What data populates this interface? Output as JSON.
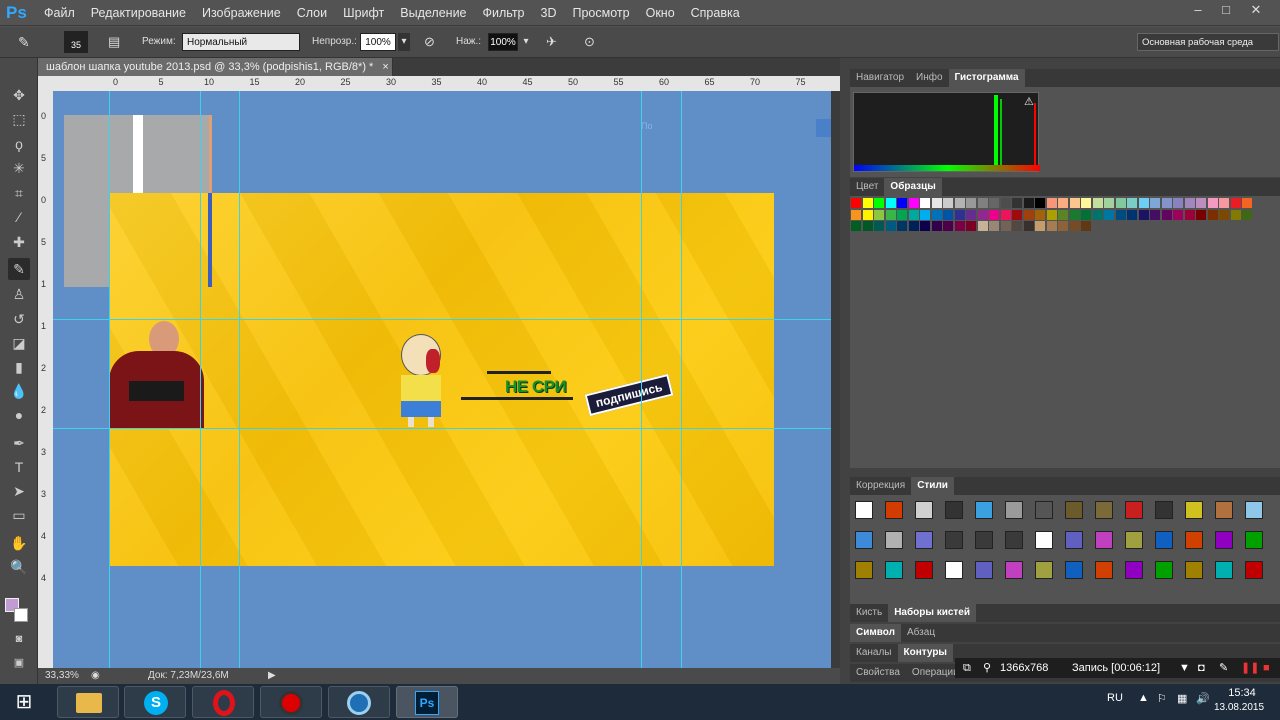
{
  "app": {
    "logo": "Ps"
  },
  "menu": [
    "Файл",
    "Редактирование",
    "Изображение",
    "Слои",
    "Шрифт",
    "Выделение",
    "Фильтр",
    "3D",
    "Просмотр",
    "Окно",
    "Справка"
  ],
  "window_controls": {
    "minimize": "–",
    "restore": "□",
    "close": "✕"
  },
  "options": {
    "brush_size": "35",
    "mode_label": "Режим:",
    "mode_value": "Нормальный",
    "opacity_label": "Непрозр.:",
    "opacity_value": "100%",
    "flow_label": "Наж.:",
    "flow_value": "100%",
    "workspace": "Основная рабочая среда"
  },
  "document": {
    "tab_title": "шаблон шапка youtube 2013.psd @ 33,3% (podpishis1, RGB/8*) *",
    "tab_close": "×",
    "zoom": "33,33%",
    "doc_size": "Док: 7,23M/23,6M",
    "ruler_h": [
      "0",
      "5",
      "10",
      "15",
      "20",
      "25",
      "30",
      "35",
      "40",
      "45",
      "50",
      "55",
      "60",
      "65",
      "70",
      "75"
    ],
    "ruler_v": [
      "0",
      "5",
      "0",
      "5",
      "1",
      "1",
      "2",
      "2",
      "3",
      "3",
      "4",
      "4"
    ],
    "canvas_text_green": "НЕ СРИ",
    "canvas_text_sticker": "подпишись",
    "canvas_faint_text": "По"
  },
  "panels": {
    "top_tabs": [
      "Навигатор",
      "Инфо",
      "Гистограмма"
    ],
    "swatch_tabs": [
      "Цвет",
      "Образцы"
    ],
    "style_tabs": [
      "Коррекция",
      "Стили"
    ],
    "brush_tabs": [
      "Кисть",
      "Наборы кистей"
    ],
    "char_tabs": [
      "Символ",
      "Абзац"
    ],
    "channel_tabs": [
      "Каналы",
      "Контуры"
    ],
    "prop_tabs": [
      "Свойства",
      "Операции"
    ]
  },
  "recorder": {
    "resolution": "1366x768",
    "record": "Запись [00:06:12]"
  },
  "taskbar": {
    "lang": "RU",
    "time": "15:34",
    "date": "13.08.2015"
  },
  "colors": {
    "accent": "#31a8ff",
    "canvas_bg": "#5f8fc6",
    "banner": "#fcc80a",
    "guide": "#39d3f0"
  },
  "swatches": [
    "#ff0000",
    "#ffff00",
    "#00ff00",
    "#00ffff",
    "#0000ff",
    "#ff00ff",
    "#ffffff",
    "#e6e6e6",
    "#cccccc",
    "#b3b3b3",
    "#999999",
    "#808080",
    "#666666",
    "#4d4d4d",
    "#333333",
    "#1a1a1a",
    "#000000",
    "#f7977a",
    "#fbad82",
    "#fdc68c",
    "#fff799",
    "#c4df9b",
    "#a3d39c",
    "#82ca9d",
    "#7bcdc8",
    "#6ecff6",
    "#7ea7d8",
    "#8493ca",
    "#8882be",
    "#a187be",
    "#bc8dbf",
    "#f49ac2",
    "#f6989d",
    "#ed1c24",
    "#f26522",
    "#f7941d",
    "#fff200",
    "#8dc63f",
    "#39b54a",
    "#00a651",
    "#00a99d",
    "#00aeef",
    "#0072bc",
    "#0054a6",
    "#2e3192",
    "#662d91",
    "#92278f",
    "#ec008c",
    "#ed145b",
    "#9e0b0f",
    "#a0410d",
    "#a36209",
    "#aba000",
    "#598527",
    "#1a7b30",
    "#007236",
    "#00746b",
    "#0076a3",
    "#004b80",
    "#003471",
    "#1b1464",
    "#440e62",
    "#630460",
    "#9e005d",
    "#9e0039",
    "#790000",
    "#7b2e00",
    "#7d4900",
    "#827b00",
    "#406618",
    "#005e20",
    "#005826",
    "#005952",
    "#005b7f",
    "#003663",
    "#002157",
    "#0d004c",
    "#32004b",
    "#4b0049",
    "#7b0046",
    "#7a0026",
    "#c7b299",
    "#998675",
    "#736357",
    "#534741",
    "#37302d",
    "#c69c6d",
    "#a67c52",
    "#8c6239",
    "#754c24",
    "#603913"
  ],
  "styles": [
    "#ffffff",
    "#d23c00",
    "#cfcfcf",
    "#333333",
    "#3aa0e0",
    "#9a9a9a",
    "#555555",
    "#6b5a2a",
    "#7a6a3a",
    "#c82020",
    "#333333",
    "#d0c020",
    "#b07040",
    "#8fc7e8",
    "#3c8ad8",
    "#b0b0b0",
    "#7070d0",
    "#3a3a3a",
    "#3a3a3a",
    "#3a3a3a",
    "#ffffff",
    "#6060c0",
    "#c040c0",
    "#a0a040",
    "#1060c0",
    "#d04000",
    "#9000c0",
    "#00a000",
    "#a08000",
    "#00b0b0",
    "#c00000",
    "#ffffff",
    "#6060c0",
    "#c040c0",
    "#a0a040",
    "#1060c0",
    "#d04000",
    "#9000c0",
    "#00a000",
    "#a08000",
    "#00b0b0",
    "#c00000"
  ]
}
